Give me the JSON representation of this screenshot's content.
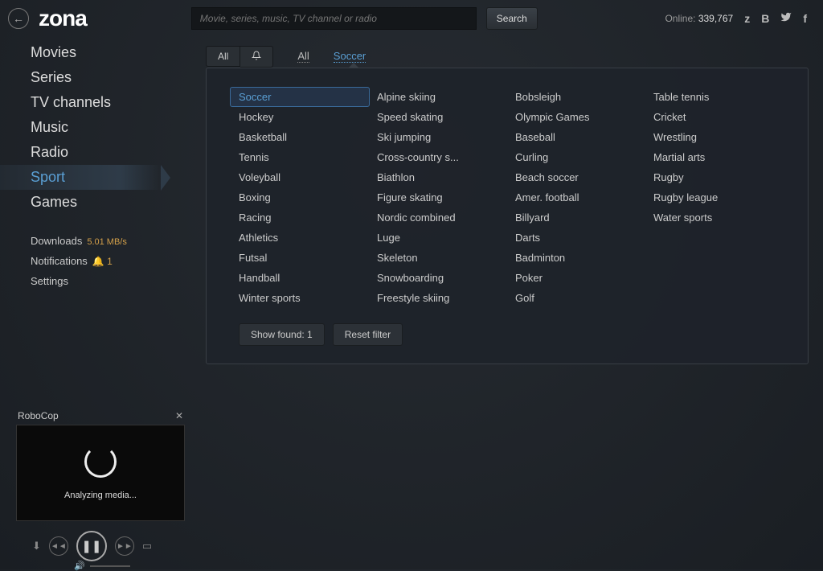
{
  "header": {
    "logo": "zona",
    "search_placeholder": "Movie, series, music, TV channel or radio",
    "search_button": "Search",
    "online_label": "Online:",
    "online_count": "339,767"
  },
  "nav": {
    "items": [
      "Movies",
      "Series",
      "TV channels",
      "Music",
      "Radio",
      "Sport",
      "Games"
    ],
    "active_index": 5
  },
  "subnav": {
    "downloads_label": "Downloads",
    "downloads_speed": "5.01 MB/s",
    "notifications_label": "Notifications",
    "notifications_count": "1",
    "settings_label": "Settings"
  },
  "filter": {
    "tab_all": "All",
    "link_all": "All",
    "link_active": "Soccer"
  },
  "sports": [
    "Soccer",
    "Hockey",
    "Basketball",
    "Tennis",
    "Voleyball",
    "Boxing",
    "Racing",
    "Athletics",
    "Futsal",
    "Handball",
    "Winter sports",
    "Alpine skiing",
    "Speed skating",
    "Ski jumping",
    "Cross-country s...",
    "Biathlon",
    "Figure skating",
    "Nordic combined",
    "Luge",
    "Skeleton",
    "Snowboarding",
    "Freestyle skiing",
    "Bobsleigh",
    "Olympic Games",
    "Baseball",
    "Curling",
    "Beach soccer",
    "Amer. football",
    "Billyard",
    "Darts",
    "Badminton",
    "Poker",
    "Golf",
    "Table tennis",
    "Cricket",
    "Wrestling",
    "Martial arts",
    "Rugby",
    "Rugby league",
    "Water sports"
  ],
  "sports_selected": "Soccer",
  "dropdown": {
    "show_found": "Show found: 1",
    "reset": "Reset filter"
  },
  "player": {
    "title": "RoboCop",
    "status": "Analyzing media..."
  }
}
